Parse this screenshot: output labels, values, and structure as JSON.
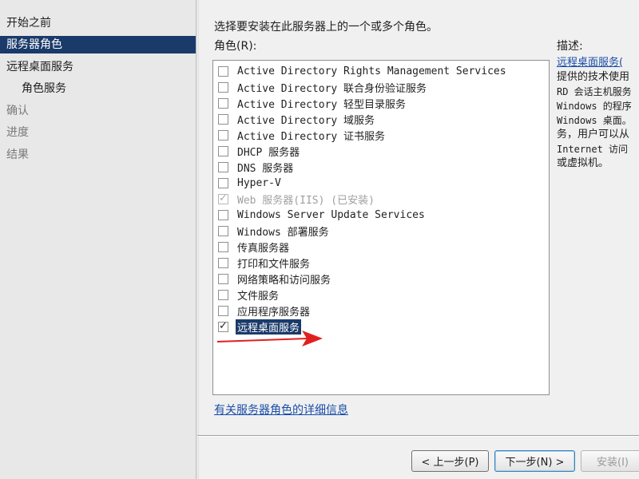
{
  "sidebar": {
    "items": [
      {
        "label": "开始之前"
      },
      {
        "label": "服务器角色"
      },
      {
        "label": "远程桌面服务"
      },
      {
        "label": "角色服务"
      },
      {
        "label": "确认"
      },
      {
        "label": "进度"
      },
      {
        "label": "结果"
      }
    ]
  },
  "main": {
    "instruction": "选择要安装在此服务器上的一个或多个角色。",
    "roles_label": "角色(R):",
    "roles": [
      {
        "label": "Active Directory Rights Management Services",
        "checked": false,
        "disabled": false
      },
      {
        "label": "Active Directory 联合身份验证服务",
        "checked": false,
        "disabled": false
      },
      {
        "label": "Active Directory 轻型目录服务",
        "checked": false,
        "disabled": false
      },
      {
        "label": "Active Directory 域服务",
        "checked": false,
        "disabled": false
      },
      {
        "label": "Active Directory 证书服务",
        "checked": false,
        "disabled": false
      },
      {
        "label": "DHCP 服务器",
        "checked": false,
        "disabled": false
      },
      {
        "label": "DNS 服务器",
        "checked": false,
        "disabled": false
      },
      {
        "label": "Hyper-V",
        "checked": false,
        "disabled": false
      },
      {
        "label": "Web 服务器(IIS)  (已安装)",
        "checked": true,
        "disabled": true
      },
      {
        "label": "Windows Server Update Services",
        "checked": false,
        "disabled": false
      },
      {
        "label": "Windows 部署服务",
        "checked": false,
        "disabled": false
      },
      {
        "label": "传真服务器",
        "checked": false,
        "disabled": false
      },
      {
        "label": "打印和文件服务",
        "checked": false,
        "disabled": false
      },
      {
        "label": "网络策略和访问服务",
        "checked": false,
        "disabled": false
      },
      {
        "label": "文件服务",
        "checked": false,
        "disabled": false
      },
      {
        "label": "应用程序服务器",
        "checked": false,
        "disabled": false
      },
      {
        "label": "远程桌面服务",
        "checked": true,
        "disabled": false,
        "selected": true
      }
    ],
    "more_info_link": "有关服务器角色的详细信息"
  },
  "description": {
    "label": "描述:",
    "link": "远程桌面服务(",
    "lines": [
      "提供的技术使用",
      "RD 会话主机服务",
      "Windows 的程序",
      "Windows 桌面。",
      "务，用户可以从",
      "Internet 访问",
      "或虚拟机。"
    ]
  },
  "buttons": {
    "prev": "< 上一步(P)",
    "next": "下一步(N) >",
    "install": "安装(I)"
  },
  "colors": {
    "selection": "#1a3a6a",
    "link": "#1a4ea8",
    "annotation_arrow": "#e02020"
  }
}
